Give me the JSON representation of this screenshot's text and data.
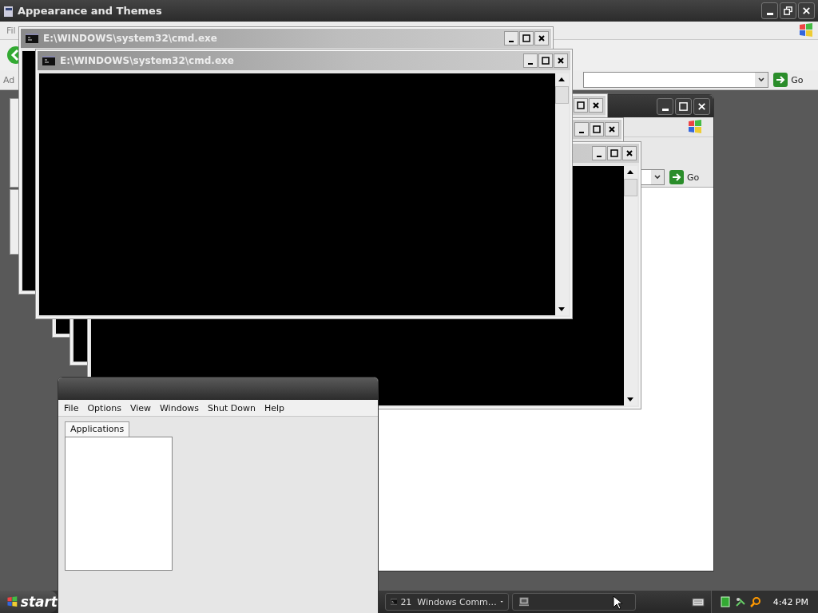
{
  "background_window": {
    "title": "Appearance and Themes",
    "menu_item": "Fil",
    "address_label": "Ad",
    "go_button": "Go"
  },
  "explorer_window": {
    "go_button": "Go"
  },
  "console_windows": [
    {
      "title": "E:\\WINDOWS\\system32\\cmd.exe"
    },
    {
      "title": "E:\\WINDOWS\\system32\\cmd.exe"
    }
  ],
  "task_manager": {
    "menu": [
      "File",
      "Options",
      "View",
      "Windows",
      "Shut Down",
      "Help"
    ],
    "tabs": [
      {
        "label": "Applications",
        "selected": true
      }
    ]
  },
  "taskbar": {
    "start_label": "start",
    "tasks": [
      {
        "kind": "group",
        "count": "21",
        "label": "Windows Comm…"
      },
      {
        "kind": "icon-only"
      }
    ],
    "clock": "4:42 PM"
  }
}
